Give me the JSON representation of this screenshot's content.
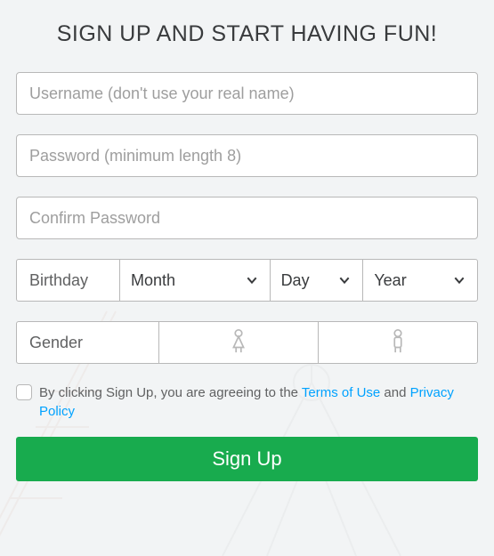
{
  "title": "SIGN UP AND START HAVING FUN!",
  "username": {
    "placeholder": "Username (don't use your real name)",
    "value": ""
  },
  "password": {
    "placeholder": "Password (minimum length 8)",
    "value": ""
  },
  "confirm": {
    "placeholder": "Confirm Password",
    "value": ""
  },
  "birthday": {
    "label": "Birthday",
    "month": "Month",
    "day": "Day",
    "year": "Year"
  },
  "gender": {
    "label": "Gender"
  },
  "terms": {
    "prefix": "By clicking Sign Up, you are agreeing to the ",
    "tou": "Terms of Use",
    "mid": " and ",
    "pp": "Privacy Policy"
  },
  "signup_label": "Sign Up",
  "colors": {
    "accent": "#18ab4e",
    "link": "#00a2ff"
  }
}
